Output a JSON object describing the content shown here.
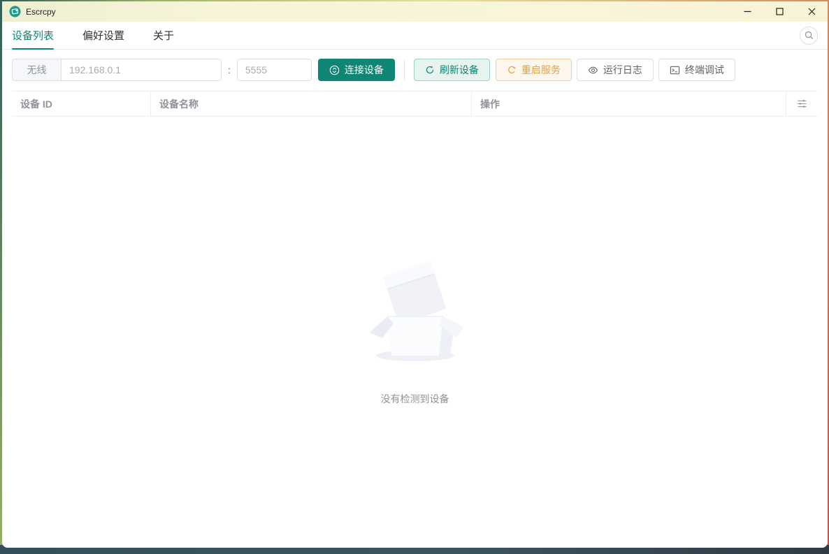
{
  "window": {
    "title": "Escrcpy",
    "controls": {
      "minimize": "minimize",
      "maximize": "maximize",
      "close": "close"
    }
  },
  "tabs": {
    "items": [
      {
        "label": "设备列表",
        "active": true
      },
      {
        "label": "偏好设置",
        "active": false
      },
      {
        "label": "关于",
        "active": false
      }
    ]
  },
  "toolbar": {
    "wireless_label": "无线",
    "host_placeholder": "192.168.0.1",
    "host_value": "",
    "port_separator": ":",
    "port_placeholder": "5555",
    "port_value": "",
    "connect_label": "连接设备",
    "refresh_label": "刷新设备",
    "restart_label": "重启服务",
    "log_label": "运行日志",
    "terminal_label": "终端调试"
  },
  "table": {
    "columns": [
      {
        "label": "设备 ID"
      },
      {
        "label": "设备名称"
      },
      {
        "label": "操作"
      }
    ]
  },
  "empty": {
    "description": "没有检测到设备"
  },
  "icons": {
    "app": "escrcpy-logo",
    "connect": "link",
    "refresh": "refresh-arrows",
    "restart": "restart-arrow",
    "log": "eye",
    "terminal": "terminal-window",
    "search": "magnifier",
    "column_settings": "sliders",
    "minimize": "–",
    "maximize": "□",
    "close": "×"
  },
  "colors": {
    "primary": "#0e8673",
    "warning": "#e6a23c",
    "titlebar": "#f7f4d9",
    "border": "#dcdfe6",
    "header_text": "#909399"
  }
}
